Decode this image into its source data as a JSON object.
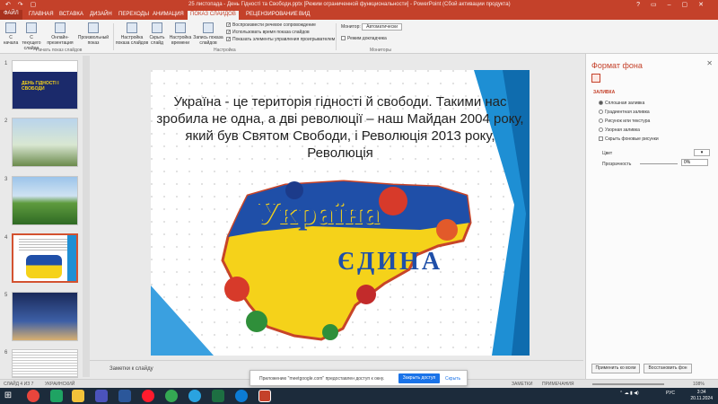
{
  "window": {
    "title": "25 листопада - День Гідності та Свободи.pptx [Режим ограниченной функциональности] - PowerPoint (Сбой активации продукта)",
    "quick_access": "↶ ↷ ▢"
  },
  "tabs": [
    "ФАЙЛ",
    "ГЛАВНАЯ",
    "ВСТАВКА",
    "ДИЗАЙН",
    "ПЕРЕХОДЫ",
    "АНИМАЦИЯ",
    "ПОКАЗ СЛАЙДОВ",
    "РЕЦЕНЗИРОВАНИЕ",
    "ВИД"
  ],
  "active_tab_index": 6,
  "ribbon": {
    "buttons": [
      "С начала",
      "С текущего слайда",
      "Онлайн-презентация",
      "Произвольный показ",
      "Настройка показа слайдов",
      "Скрыть слайд",
      "Настройка времени",
      "Запись показа слайдов"
    ],
    "checkboxes": [
      "Воспроизвести речевое сопровождение",
      "Использовать время показа слайдов",
      "Показать элементы управления проигрывателем"
    ],
    "monitor_label": "Монитор:",
    "monitor_value": "Автоматически",
    "presenter_view": "Режим докладчика",
    "groups": [
      "Начать показ слайдов",
      "Настройка",
      "Мониторы"
    ]
  },
  "thumbnails": [
    {
      "num": "1",
      "label": "ДЕНЬ ГІДНОСТІ І СВОБОДИ"
    },
    {
      "num": "2",
      "label": ""
    },
    {
      "num": "3",
      "label": ""
    },
    {
      "num": "4",
      "label": "Україна єдина"
    },
    {
      "num": "5",
      "label": ""
    },
    {
      "num": "6",
      "label": ""
    }
  ],
  "slide": {
    "text": "Україна - це територія гідності й свободи. Такими нас зробила не одна, а дві революції – наш Майдан 2004 року, який був Святом Свободи, і Революція 2013 року, Революція",
    "map_word1": "Україна",
    "map_word2": "ЄДИНА"
  },
  "notes_placeholder": "Заметки к слайду",
  "format_panel": {
    "title": "Формат фона",
    "section": "ЗАЛИВКА",
    "options": [
      "Сплошная заливка",
      "Градиентная заливка",
      "Рисунок или текстура",
      "Узорная заливка",
      "Скрыть фоновые рисунки"
    ],
    "color_label": "Цвет",
    "transparency_label": "Прозрачность",
    "transparency_value": "0%",
    "apply_all": "Применить ко всем",
    "reset_bg": "Восстановить фон"
  },
  "statusbar": {
    "slide_info": "СЛАЙД 4 ИЗ 7",
    "lang": "УКРАИНСКИЙ",
    "notes": "ЗАМЕТКИ",
    "comments": "ПРИМЕЧАНИЯ",
    "zoom": "108%"
  },
  "infobar": {
    "message": "Приложению \"meetgoogle.com\" предоставлен доступ к окну.",
    "open_button": "Закрыть доступ",
    "hide_link": "Скрыть"
  },
  "taskbar": {
    "lang": "РУС",
    "time": "3:34",
    "date": "20.11.2024"
  },
  "colors": {
    "accent": "#c4412a",
    "slide_blue": "#1e8fd4",
    "ukraine_yellow": "#f5d21a",
    "ukraine_blue": "#1f4fa8"
  }
}
